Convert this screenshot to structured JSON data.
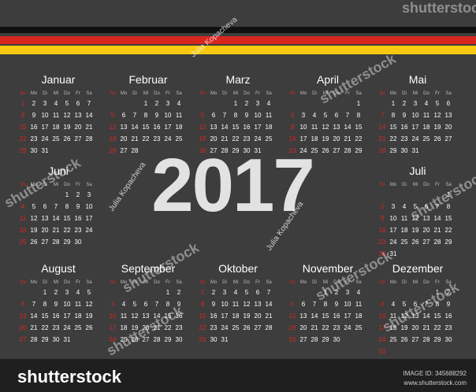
{
  "year": "2017",
  "weekdays": [
    "So",
    "Mo",
    "Di",
    "Mi",
    "Do",
    "Fr",
    "Sa"
  ],
  "months": [
    {
      "name": "Januar",
      "offset": 0,
      "days": 31
    },
    {
      "name": "Februar",
      "offset": 3,
      "days": 28
    },
    {
      "name": "Marz",
      "offset": 3,
      "days": 31
    },
    {
      "name": "April",
      "offset": 6,
      "days": 30
    },
    {
      "name": "Mai",
      "offset": 1,
      "days": 31
    },
    {
      "name": "Juni",
      "offset": 4,
      "days": 30
    },
    {
      "name": "Juli",
      "offset": 6,
      "days": 31
    },
    {
      "name": "August",
      "offset": 2,
      "days": 31
    },
    {
      "name": "September",
      "offset": 5,
      "days": 30
    },
    {
      "name": "Oktober",
      "offset": 0,
      "days": 31
    },
    {
      "name": "November",
      "offset": 3,
      "days": 30
    },
    {
      "name": "Dezember",
      "offset": 5,
      "days": 31
    }
  ],
  "colors": {
    "background": "#3d3d3d",
    "sunday": "#d8261f",
    "flag_black": "#111111",
    "flag_red": "#d8261f",
    "flag_gold": "#f6c90e"
  },
  "watermark": {
    "brand": "shutterstock",
    "author": "Julia Kopacheva"
  },
  "footer": {
    "logo": "shutterstock",
    "image_id": "IMAGE ID: 345688292",
    "url": "www.shutterstock.com"
  }
}
